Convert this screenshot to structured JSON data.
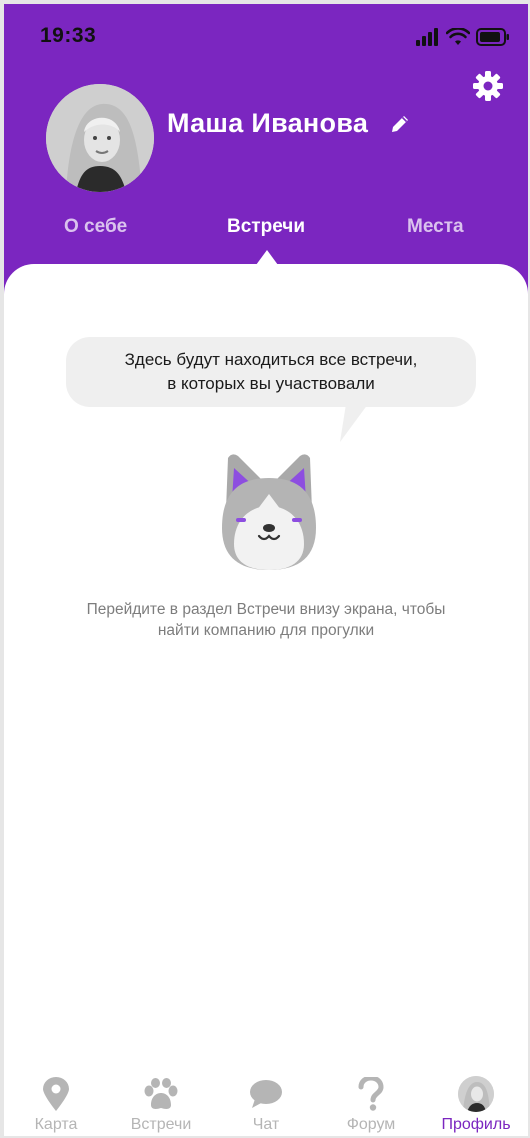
{
  "status_bar": {
    "time": "19:33"
  },
  "profile": {
    "name": "Маша Иванова",
    "avatar_icon": "user-photo"
  },
  "tabs": [
    {
      "label": "О себе",
      "active": false
    },
    {
      "label": "Встречи",
      "active": true
    },
    {
      "label": "Места",
      "active": false
    }
  ],
  "empty_state": {
    "bubble_line1": "Здесь будут находиться все встречи,",
    "bubble_line2": "в которых вы участвовали",
    "hint_line1": "Перейдите в раздел Встречи внизу экрана, чтобы",
    "hint_line2": "найти компанию для прогулки",
    "mascot_icon": "dog-mascot"
  },
  "bottom_nav": [
    {
      "label": "Карта",
      "icon": "map-pin-icon",
      "active": false
    },
    {
      "label": "Встречи",
      "icon": "paw-icon",
      "active": false
    },
    {
      "label": "Чат",
      "icon": "chat-bubble-icon",
      "active": false
    },
    {
      "label": "Форум",
      "icon": "question-icon",
      "active": false
    },
    {
      "label": "Профиль",
      "icon": "avatar-icon",
      "active": true
    }
  ],
  "colors": {
    "brand_purple": "#7b26c0",
    "inactive_gray": "#b5b5b5",
    "bubble_bg": "#efefef"
  }
}
